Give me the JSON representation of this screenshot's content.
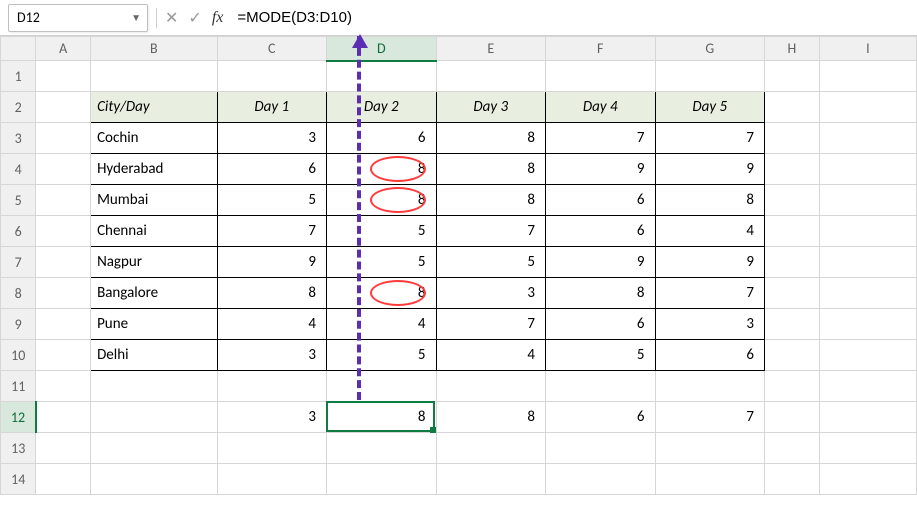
{
  "namebox": {
    "value": "D12"
  },
  "formula": {
    "value": "=MODE(D3:D10)"
  },
  "columns": [
    "A",
    "B",
    "C",
    "D",
    "E",
    "F",
    "G",
    "H",
    "I"
  ],
  "rows": [
    "1",
    "2",
    "3",
    "4",
    "5",
    "6",
    "7",
    "8",
    "9",
    "10",
    "11",
    "12",
    "13",
    "14"
  ],
  "selected": {
    "col": "D",
    "row": "12"
  },
  "table": {
    "header": [
      "City/Day",
      "Day 1",
      "Day 2",
      "Day 3",
      "Day 4",
      "Day 5"
    ],
    "cities": [
      "Cochin",
      "Hyderabad",
      "Mumbai",
      "Chennai",
      "Nagpur",
      "Bangalore",
      "Pune",
      "Delhi"
    ],
    "data": [
      [
        3,
        6,
        8,
        7,
        7
      ],
      [
        6,
        8,
        8,
        9,
        9
      ],
      [
        5,
        8,
        8,
        6,
        8
      ],
      [
        7,
        5,
        7,
        6,
        4
      ],
      [
        9,
        5,
        5,
        9,
        9
      ],
      [
        8,
        8,
        3,
        8,
        7
      ],
      [
        4,
        4,
        7,
        6,
        3
      ],
      [
        3,
        5,
        4,
        5,
        6
      ]
    ]
  },
  "mode_row": [
    3,
    8,
    8,
    6,
    7
  ],
  "chart_data": {
    "type": "table",
    "title": "City/Day values with MODE of each Day column",
    "columns": [
      "City/Day",
      "Day 1",
      "Day 2",
      "Day 3",
      "Day 4",
      "Day 5"
    ],
    "rows": [
      [
        "Cochin",
        3,
        6,
        8,
        7,
        7
      ],
      [
        "Hyderabad",
        6,
        8,
        8,
        9,
        9
      ],
      [
        "Mumbai",
        5,
        8,
        8,
        6,
        8
      ],
      [
        "Chennai",
        7,
        5,
        7,
        6,
        4
      ],
      [
        "Nagpur",
        9,
        5,
        5,
        9,
        9
      ],
      [
        "Bangalore",
        8,
        8,
        3,
        8,
        7
      ],
      [
        "Pune",
        4,
        4,
        7,
        6,
        3
      ],
      [
        "Delhi",
        3,
        5,
        4,
        5,
        6
      ]
    ],
    "mode_per_column": {
      "Day 1": 3,
      "Day 2": 8,
      "Day 3": 8,
      "Day 4": 6,
      "Day 5": 7
    },
    "highlighted": {
      "column": "Day 2",
      "values_circled": [
        8,
        8,
        8
      ],
      "at_rows": [
        "Hyderabad",
        "Mumbai",
        "Bangalore"
      ]
    },
    "formula_shown": "=MODE(D3:D10)",
    "active_cell": "D12"
  }
}
